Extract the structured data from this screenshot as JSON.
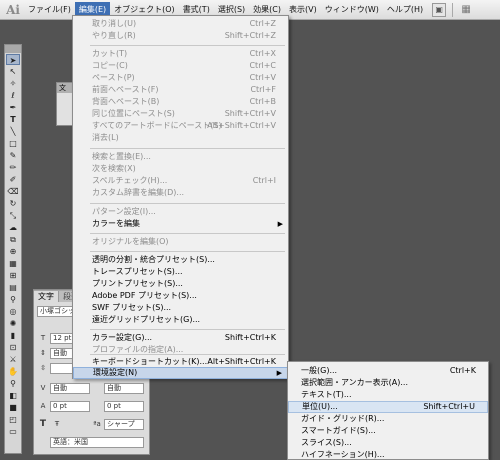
{
  "app": {
    "logo": "Ai"
  },
  "menubar": {
    "items": [
      "ファイル(F)",
      "編集(E)",
      "オブジェクト(O)",
      "書式(T)",
      "選択(S)",
      "効果(C)",
      "表示(V)",
      "ウィンドウ(W)",
      "ヘルプ(H)"
    ],
    "active_index": 1
  },
  "edit_menu": {
    "items": [
      {
        "label": "取り消し(U)",
        "shortcut": "Ctrl+Z",
        "enabled": false
      },
      {
        "label": "やり直し(R)",
        "shortcut": "Shift+Ctrl+Z",
        "enabled": false
      },
      {
        "label": "カット(T)",
        "shortcut": "Ctrl+X",
        "enabled": false
      },
      {
        "label": "コピー(C)",
        "shortcut": "Ctrl+C",
        "enabled": false
      },
      {
        "label": "ペースト(P)",
        "shortcut": "Ctrl+V",
        "enabled": false
      },
      {
        "label": "前面へペースト(F)",
        "shortcut": "Ctrl+F",
        "enabled": false
      },
      {
        "label": "背面へペースト(B)",
        "shortcut": "Ctrl+B",
        "enabled": false
      },
      {
        "label": "同じ位置にペースト(S)",
        "shortcut": "Shift+Ctrl+V",
        "enabled": false
      },
      {
        "label": "すべてのアートボードにペースト(S)",
        "shortcut": "Alt+Shift+Ctrl+V",
        "enabled": false
      },
      {
        "label": "消去(L)",
        "shortcut": "",
        "enabled": false
      },
      {
        "label": "検索と置換(E)...",
        "shortcut": "",
        "enabled": false
      },
      {
        "label": "次を検索(X)",
        "shortcut": "",
        "enabled": false
      },
      {
        "label": "スペルチェック(H)...",
        "shortcut": "Ctrl+I",
        "enabled": false
      },
      {
        "label": "カスタム辞書を編集(D)...",
        "shortcut": "",
        "enabled": false
      },
      {
        "label": "パターン設定(I)...",
        "shortcut": "",
        "enabled": false
      },
      {
        "label": "カラーを編集",
        "shortcut": "",
        "enabled": true,
        "submenu": true
      },
      {
        "label": "オリジナルを編集(O)",
        "shortcut": "",
        "enabled": false
      },
      {
        "label": "透明の分割・統合プリセット(S)...",
        "shortcut": "",
        "enabled": true
      },
      {
        "label": "トレースプリセット(S)...",
        "shortcut": "",
        "enabled": true
      },
      {
        "label": "プリントプリセット(S)...",
        "shortcut": "",
        "enabled": true
      },
      {
        "label": "Adobe PDF プリセット(S)...",
        "shortcut": "",
        "enabled": true
      },
      {
        "label": "SWF プリセット(S)...",
        "shortcut": "",
        "enabled": true
      },
      {
        "label": "遠近グリッドプリセット(G)...",
        "shortcut": "",
        "enabled": true
      },
      {
        "label": "カラー設定(G)...",
        "shortcut": "Shift+Ctrl+K",
        "enabled": true
      },
      {
        "label": "プロファイルの指定(A)...",
        "shortcut": "",
        "enabled": false
      },
      {
        "label": "キーボードショートカット(K)...",
        "shortcut": "Alt+Shift+Ctrl+K",
        "enabled": true
      },
      {
        "label": "環境設定(N)",
        "shortcut": "",
        "enabled": true,
        "submenu": true,
        "highlighted": true
      }
    ]
  },
  "prefs_submenu": {
    "items": [
      {
        "label": "一般(G)...",
        "shortcut": "Ctrl+K"
      },
      {
        "label": "選択範囲・アンカー表示(A)...",
        "shortcut": ""
      },
      {
        "label": "テキスト(T)...",
        "shortcut": ""
      },
      {
        "label": "単位(U)...",
        "shortcut": "Shift+Ctrl+U",
        "highlighted": true
      },
      {
        "label": "ガイド・グリッド(R)...",
        "shortcut": ""
      },
      {
        "label": "スマートガイド(S)...",
        "shortcut": ""
      },
      {
        "label": "スライス(S)...",
        "shortcut": ""
      },
      {
        "label": "ハイフネーション(H)...",
        "shortcut": ""
      }
    ]
  },
  "character_panel": {
    "tabs": [
      "文字",
      "段落"
    ],
    "font_name": "小塚ゴシック",
    "font_size": "12 pt",
    "leading": "自動",
    "kerning": "自動",
    "tracking_value": "0 pt",
    "aa_method": "シャープ",
    "language": "英語：米国"
  },
  "left_panel_fragment": {
    "tab": "文"
  }
}
